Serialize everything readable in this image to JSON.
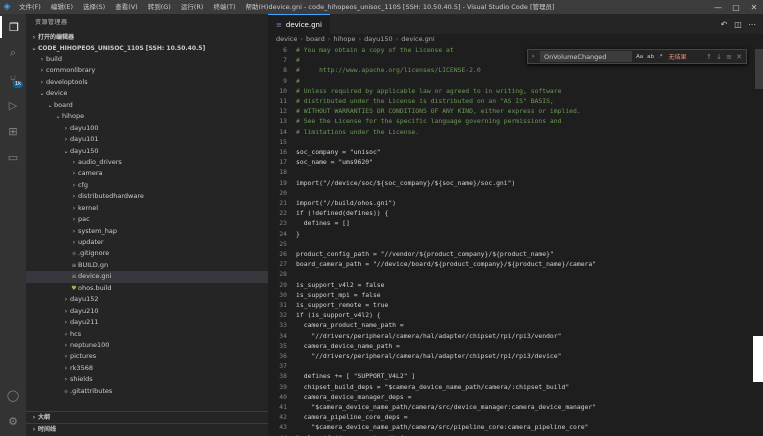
{
  "titlebar": {
    "menu": [
      "文件(F)",
      "编辑(E)",
      "选择(S)",
      "查看(V)",
      "转到(G)",
      "运行(R)",
      "终端(T)",
      "帮助(H)"
    ],
    "window_title": "device.gni - code_hihopeos_unisoc_110S [SSH: 10.50.40.5] - Visual Studio Code [管理员]",
    "controls": [
      "—",
      "▢",
      "✕"
    ]
  },
  "activity_bar": {
    "badge": "1k"
  },
  "sidebar": {
    "title": "资源管理器",
    "open_editors": "打开的编辑器",
    "workspace": "CODE_HIHOPEOS_UNISOC_110S [SSH: 10.50.40.5]",
    "tree": [
      {
        "label": "build",
        "depth": 1,
        "type": "folder",
        "open": false
      },
      {
        "label": "commonlibrary",
        "depth": 1,
        "type": "folder",
        "open": false
      },
      {
        "label": "developtools",
        "depth": 1,
        "type": "folder",
        "open": false
      },
      {
        "label": "device",
        "depth": 1,
        "type": "folder",
        "open": true
      },
      {
        "label": "board",
        "depth": 2,
        "type": "folder",
        "open": true
      },
      {
        "label": "hihope",
        "depth": 3,
        "type": "folder",
        "open": true
      },
      {
        "label": "dayu100",
        "depth": 4,
        "type": "folder",
        "open": false
      },
      {
        "label": "dayu101",
        "depth": 4,
        "type": "folder",
        "open": false
      },
      {
        "label": "dayu150",
        "depth": 4,
        "type": "folder",
        "open": true
      },
      {
        "label": "audio_drivers",
        "depth": 5,
        "type": "folder",
        "open": false
      },
      {
        "label": "camera",
        "depth": 5,
        "type": "folder",
        "open": false
      },
      {
        "label": "cfg",
        "depth": 5,
        "type": "folder",
        "open": false
      },
      {
        "label": "distributedhardware",
        "depth": 5,
        "type": "folder",
        "open": false
      },
      {
        "label": "kernel",
        "depth": 5,
        "type": "folder",
        "open": false
      },
      {
        "label": "pac",
        "depth": 5,
        "type": "folder",
        "open": false
      },
      {
        "label": "system_hap",
        "depth": 5,
        "type": "folder",
        "open": false
      },
      {
        "label": "updater",
        "depth": 5,
        "type": "folder",
        "open": false
      },
      {
        "label": ".gitignore",
        "depth": 5,
        "type": "file",
        "icon": "◆",
        "icon_color": "#41535b"
      },
      {
        "label": "BUILD.gn",
        "depth": 5,
        "type": "file",
        "icon": "≡",
        "icon_color": "#a0a0a0"
      },
      {
        "label": "device.gni",
        "depth": 5,
        "type": "file",
        "icon": "≡",
        "icon_color": "#a0a0a0",
        "selected": true
      },
      {
        "label": "ohos.build",
        "depth": 5,
        "type": "file",
        "icon": "♥",
        "icon_color": "#8dc149"
      },
      {
        "label": "dayu152",
        "depth": 4,
        "type": "folder",
        "open": false
      },
      {
        "label": "dayu210",
        "depth": 4,
        "type": "folder",
        "open": false
      },
      {
        "label": "dayu211",
        "depth": 4,
        "type": "folder",
        "open": false
      },
      {
        "label": "hcs",
        "depth": 4,
        "type": "folder",
        "open": false
      },
      {
        "label": "neptune100",
        "depth": 4,
        "type": "folder",
        "open": false
      },
      {
        "label": "pictures",
        "depth": 4,
        "type": "folder",
        "open": false
      },
      {
        "label": "rk3568",
        "depth": 4,
        "type": "folder",
        "open": false
      },
      {
        "label": "shields",
        "depth": 4,
        "type": "folder",
        "open": false
      },
      {
        "label": ".gitattributes",
        "depth": 4,
        "type": "file",
        "icon": "◆",
        "icon_color": "#41535b"
      }
    ],
    "outline": "大纲",
    "timeline": "时间线"
  },
  "editor": {
    "tab_label": "device.gni",
    "breadcrumb": [
      "device",
      "board",
      "hihope",
      "dayu150",
      "device.gni"
    ],
    "first_line": 6,
    "lines": [
      {
        "kind": "cmt",
        "text": "# You may obtain a copy of the License at"
      },
      {
        "kind": "cmt",
        "text": "#"
      },
      {
        "kind": "cmt",
        "text": "#     http://www.apache.org/licenses/LICENSE-2.0"
      },
      {
        "kind": "cmt",
        "text": "#"
      },
      {
        "kind": "cmt",
        "text": "# Unless required by applicable law or agreed to in writing, software"
      },
      {
        "kind": "cmt",
        "text": "# distributed under the License is distributed on an \"AS IS\" BASIS,"
      },
      {
        "kind": "cmt",
        "text": "# WITHOUT WARRANTIES OR CONDITIONS OF ANY KIND, either express or implied."
      },
      {
        "kind": "cmt",
        "text": "# See the License for the specific language governing permissions and"
      },
      {
        "kind": "cmt",
        "text": "# limitations under the License."
      },
      {
        "kind": "code",
        "text": ""
      },
      {
        "kind": "code",
        "text": "soc_company = \"unisoc\""
      },
      {
        "kind": "code",
        "text": "soc_name = \"ums9620\""
      },
      {
        "kind": "code",
        "text": ""
      },
      {
        "kind": "code",
        "text": "import(\"//device/soc/${soc_company}/${soc_name}/soc.gni\")"
      },
      {
        "kind": "code",
        "text": ""
      },
      {
        "kind": "code",
        "text": "import(\"//build/ohos.gni\")"
      },
      {
        "kind": "code",
        "text": "if (!defined(defines)) {"
      },
      {
        "kind": "code",
        "text": "  defines = []"
      },
      {
        "kind": "code",
        "text": "}"
      },
      {
        "kind": "code",
        "text": ""
      },
      {
        "kind": "code",
        "text": "product_config_path = \"//vendor/${product_company}/${product_name}\""
      },
      {
        "kind": "code",
        "text": "board_camera_path = \"//device/board/${product_company}/${product_name}/camera\""
      },
      {
        "kind": "code",
        "text": ""
      },
      {
        "kind": "code",
        "text": "is_support_v4l2 = false"
      },
      {
        "kind": "code",
        "text": "is_support_mpi = false"
      },
      {
        "kind": "code",
        "text": "is_support_remote = true"
      },
      {
        "kind": "code",
        "text": "if (is_support_v4l2) {"
      },
      {
        "kind": "code",
        "text": "  camera_product_name_path ="
      },
      {
        "kind": "code",
        "text": "    \"//drivers/peripheral/camera/hal/adapter/chipset/rpi/rpi3/vendor\""
      },
      {
        "kind": "code",
        "text": "  camera_device_name_path ="
      },
      {
        "kind": "code",
        "text": "    \"//drivers/peripheral/camera/hal/adapter/chipset/rpi/rpi3/device\""
      },
      {
        "kind": "code",
        "text": ""
      },
      {
        "kind": "code",
        "text": "  defines += [ \"SUPPORT_V4L2\" ]"
      },
      {
        "kind": "code",
        "text": "  chipset_build_deps = \"$camera_device_name_path/camera/:chipset_build\""
      },
      {
        "kind": "code",
        "text": "  camera_device_manager_deps ="
      },
      {
        "kind": "code",
        "text": "    \"$camera_device_name_path/camera/src/device_manager:camera_device_manager\""
      },
      {
        "kind": "code",
        "text": "  camera_pipeline_core_deps ="
      },
      {
        "kind": "code",
        "text": "    \"$camera_device_name_path/camera/src/pipeline_core:camera_pipeline_core\""
      },
      {
        "kind": "code",
        "text": "} else if (is_support_mpi) {"
      }
    ]
  },
  "find_widget": {
    "query": "OnVolumeChanged",
    "options": [
      "Aa",
      "ab",
      ".*"
    ],
    "no_results": "无结果",
    "buttons": [
      "↑",
      "↓",
      "≡",
      "✕"
    ]
  }
}
